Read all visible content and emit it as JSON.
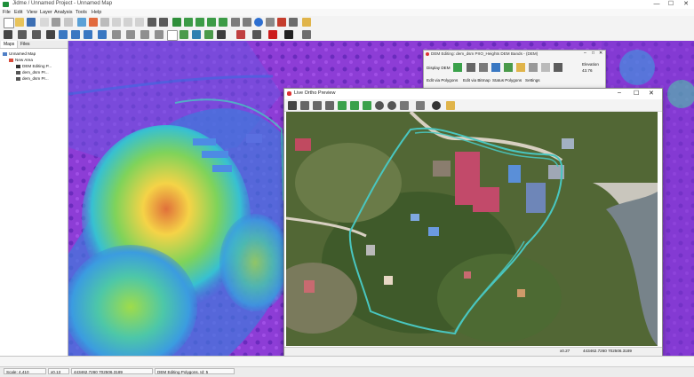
{
  "window": {
    "title": "Jidme / Unnamed Project - Unnamed Map",
    "minimize_glyph": "—",
    "maximize_glyph": "☐",
    "close_glyph": "✕"
  },
  "menubar": {
    "items": [
      "File",
      "Edit",
      "View",
      "Layer",
      "Analysis",
      "Tools",
      "Help"
    ]
  },
  "left_panel": {
    "tabs": [
      "Maps",
      "Files"
    ],
    "tree": [
      {
        "label": "Unnamed Map",
        "indent": 0
      },
      {
        "label": "New Area",
        "indent": 1
      },
      {
        "label": "DEM Editing P...",
        "indent": 2
      },
      {
        "label": "dem_dsm Pr...",
        "indent": 2
      },
      {
        "label": "dem_dsm Pr...",
        "indent": 2
      }
    ]
  },
  "dem_panel": {
    "title": "DEM Editing: dem_dsm PrIO_Heights DEM Bands - (DEM)",
    "display_label": "Display DEM",
    "elevation_label": "Elevation",
    "elevation_value": "43.76",
    "tabs": [
      "Edit via Polygons",
      "Edit via Bitmap",
      "Status Polygons",
      "Settings"
    ]
  },
  "preview_window": {
    "title": "Live Ortho Preview",
    "status_left": "x0.27",
    "status_right": "443462.7260 702506.3189"
  },
  "statusbar": {
    "scale": "Scale: 4,410",
    "zoom": "x0.13",
    "coords": "443462.7260 702506.3189",
    "layer": "DEM Editing Polygons. Id: 5"
  },
  "colors": {
    "dem_low": "#8d3dd6",
    "dem_mid": "#37c0d2",
    "dem_high": "#f5d347",
    "dem_peak": "#e0703a",
    "polygon_line": "#49c6c0"
  }
}
